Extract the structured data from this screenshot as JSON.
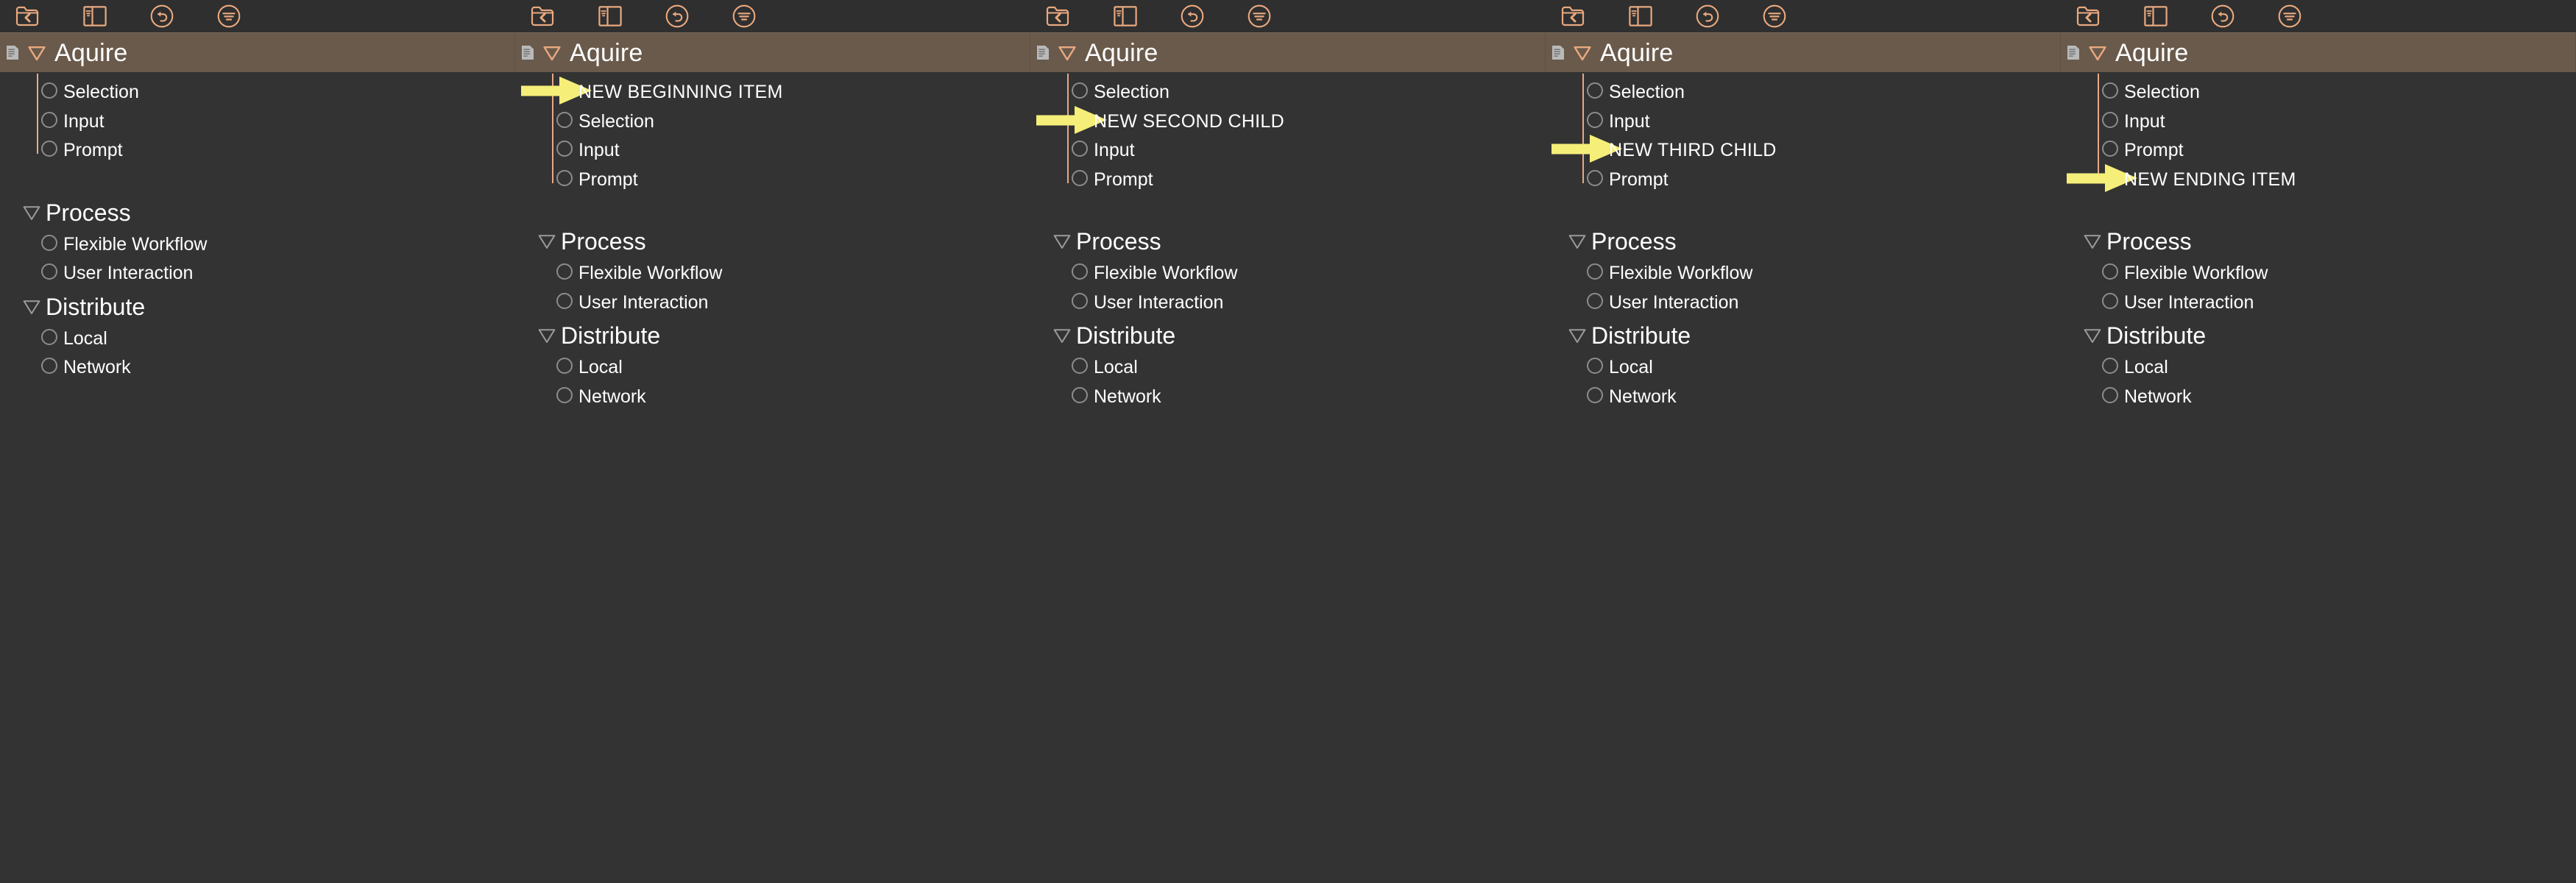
{
  "colors": {
    "app_background": "#333333",
    "toolbar_background": "#2f2f2f",
    "header_brown": "#695a4c",
    "icon_peach": "#e9a97f",
    "connector_salmon": "#e8a887",
    "bullet_gray": "#8c8c8c",
    "text_white": "#ffffff",
    "annotation_yellow": "#f5ee79"
  },
  "toolbar": {
    "buttons": [
      {
        "icon": "folder-back-icon",
        "label": "Back"
      },
      {
        "icon": "split-panel-icon",
        "label": "Split Panel"
      },
      {
        "icon": "undo-circle-icon",
        "label": "Undo"
      },
      {
        "icon": "filter-circle-icon",
        "label": "Filter"
      }
    ]
  },
  "header": {
    "doc_icon": "document-lines-icon",
    "disclosure_icon": "triangle-down-icon",
    "title": "Aquire"
  },
  "sections": [
    {
      "name": "process-section",
      "disclosure_icon": "triangle-down-icon",
      "title": "Process",
      "items": [
        "Flexible Workflow",
        "User Interaction"
      ]
    },
    {
      "name": "distribute-section",
      "disclosure_icon": "triangle-down-icon",
      "title": "Distribute",
      "items": [
        "Local",
        "Network"
      ]
    }
  ],
  "panels": [
    {
      "name": "panel-original",
      "children": [
        {
          "label": "Selection",
          "kind": "item"
        },
        {
          "label": "Input",
          "kind": "item"
        },
        {
          "label": "Prompt",
          "kind": "item"
        }
      ],
      "annotation": null
    },
    {
      "name": "panel-new-beginning",
      "children": [
        {
          "label": "NEW BEGINNING ITEM",
          "kind": "new"
        },
        {
          "label": "Selection",
          "kind": "item"
        },
        {
          "label": "Input",
          "kind": "item"
        },
        {
          "label": "Prompt",
          "kind": "item"
        }
      ],
      "annotation": {
        "text": "NEW BEGINNING ITEM",
        "target_index": 0
      }
    },
    {
      "name": "panel-new-second",
      "children": [
        {
          "label": "Selection",
          "kind": "item"
        },
        {
          "label": "NEW SECOND CHILD",
          "kind": "new"
        },
        {
          "label": "Input",
          "kind": "item"
        },
        {
          "label": "Prompt",
          "kind": "item"
        }
      ],
      "annotation": {
        "text": "NEW SECOND CHILD",
        "target_index": 1
      }
    },
    {
      "name": "panel-new-third",
      "children": [
        {
          "label": "Selection",
          "kind": "item"
        },
        {
          "label": "Input",
          "kind": "item"
        },
        {
          "label": "NEW THIRD CHILD",
          "kind": "new"
        },
        {
          "label": "Prompt",
          "kind": "item"
        }
      ],
      "annotation": {
        "text": "NEW THIRD CHILD",
        "target_index": 2
      }
    },
    {
      "name": "panel-new-ending",
      "children": [
        {
          "label": "Selection",
          "kind": "item"
        },
        {
          "label": "Input",
          "kind": "item"
        },
        {
          "label": "Prompt",
          "kind": "item"
        },
        {
          "label": "NEW ENDING ITEM",
          "kind": "new"
        }
      ],
      "annotation": {
        "text": "NEW ENDING ITEM",
        "target_index": 3
      }
    }
  ]
}
